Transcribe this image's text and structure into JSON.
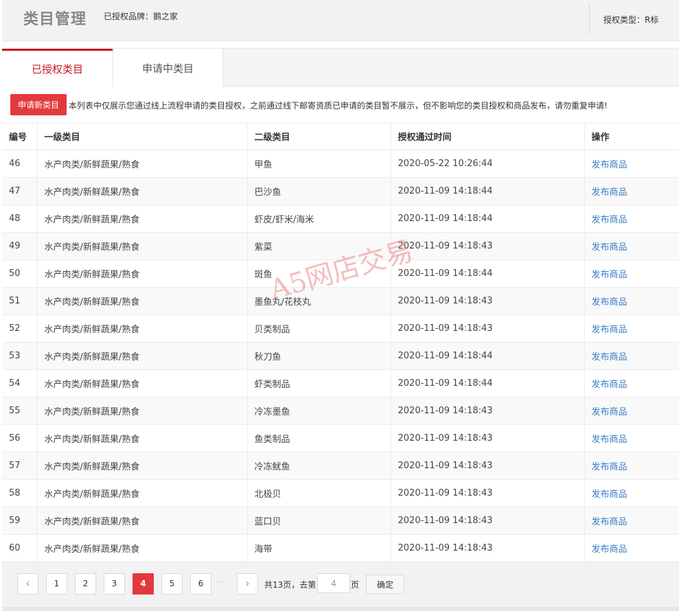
{
  "header": {
    "title": "类目管理",
    "brand": "已授权品牌：鹅之家",
    "auth_type": "授权类型：R标"
  },
  "tabs": {
    "active": "已授权类目",
    "pending": "申请中类目"
  },
  "notice": {
    "apply_button": "申请新类目",
    "text": "本列表中仅展示您通过线上流程申请的类目授权，之前通过线下邮寄资质已申请的类目暂不展示，但不影响您的类目授权和商品发布，请勿重复申请!"
  },
  "table": {
    "columns": [
      "编号",
      "一级类目",
      "二级类目",
      "授权通过时间",
      "操作"
    ],
    "rows": [
      {
        "id": "46",
        "level1": "水产肉类/新鲜蔬果/熟食",
        "level2": "甲鱼",
        "time": "2020-05-22 10:26:44",
        "action": "发布商品"
      },
      {
        "id": "47",
        "level1": "水产肉类/新鲜蔬果/熟食",
        "level2": "巴沙鱼",
        "time": "2020-11-09 14:18:44",
        "action": "发布商品"
      },
      {
        "id": "48",
        "level1": "水产肉类/新鲜蔬果/熟食",
        "level2": "虾皮/虾米/海米",
        "time": "2020-11-09 14:18:44",
        "action": "发布商品"
      },
      {
        "id": "49",
        "level1": "水产肉类/新鲜蔬果/熟食",
        "level2": "紫菜",
        "time": "2020-11-09 14:18:43",
        "action": "发布商品"
      },
      {
        "id": "50",
        "level1": "水产肉类/新鲜蔬果/熟食",
        "level2": "斑鱼",
        "time": "2020-11-09 14:18:44",
        "action": "发布商品"
      },
      {
        "id": "51",
        "level1": "水产肉类/新鲜蔬果/熟食",
        "level2": "墨鱼丸/花枝丸",
        "time": "2020-11-09 14:18:43",
        "action": "发布商品"
      },
      {
        "id": "52",
        "level1": "水产肉类/新鲜蔬果/熟食",
        "level2": "贝类制品",
        "time": "2020-11-09 14:18:43",
        "action": "发布商品"
      },
      {
        "id": "53",
        "level1": "水产肉类/新鲜蔬果/熟食",
        "level2": "秋刀鱼",
        "time": "2020-11-09 14:18:44",
        "action": "发布商品"
      },
      {
        "id": "54",
        "level1": "水产肉类/新鲜蔬果/熟食",
        "level2": "虾类制品",
        "time": "2020-11-09 14:18:44",
        "action": "发布商品"
      },
      {
        "id": "55",
        "level1": "水产肉类/新鲜蔬果/熟食",
        "level2": "冷冻墨鱼",
        "time": "2020-11-09 14:18:43",
        "action": "发布商品"
      },
      {
        "id": "56",
        "level1": "水产肉类/新鲜蔬果/熟食",
        "level2": "鱼类制品",
        "time": "2020-11-09 14:18:43",
        "action": "发布商品"
      },
      {
        "id": "57",
        "level1": "水产肉类/新鲜蔬果/熟食",
        "level2": "冷冻鱿鱼",
        "time": "2020-11-09 14:18:43",
        "action": "发布商品"
      },
      {
        "id": "58",
        "level1": "水产肉类/新鲜蔬果/熟食",
        "level2": "北极贝",
        "time": "2020-11-09 14:18:43",
        "action": "发布商品"
      },
      {
        "id": "59",
        "level1": "水产肉类/新鲜蔬果/熟食",
        "level2": "蓝口贝",
        "time": "2020-11-09 14:18:43",
        "action": "发布商品"
      },
      {
        "id": "60",
        "level1": "水产肉类/新鲜蔬果/熟食",
        "level2": "海带",
        "time": "2020-11-09 14:18:43",
        "action": "发布商品"
      }
    ]
  },
  "watermark": "A5网店交易",
  "pagination": {
    "prev_icon": "‹",
    "next_icon": "›",
    "pages": [
      "1",
      "2",
      "3",
      "4",
      "5",
      "6"
    ],
    "current": "4",
    "ellipsis": "···",
    "total_text": "共13页，去第",
    "goto_value": "4",
    "unit": "页",
    "confirm": "确定"
  },
  "colors": {
    "accent": "#e4393c",
    "tab_active": "#c8191d",
    "link": "#3a7cc6"
  }
}
